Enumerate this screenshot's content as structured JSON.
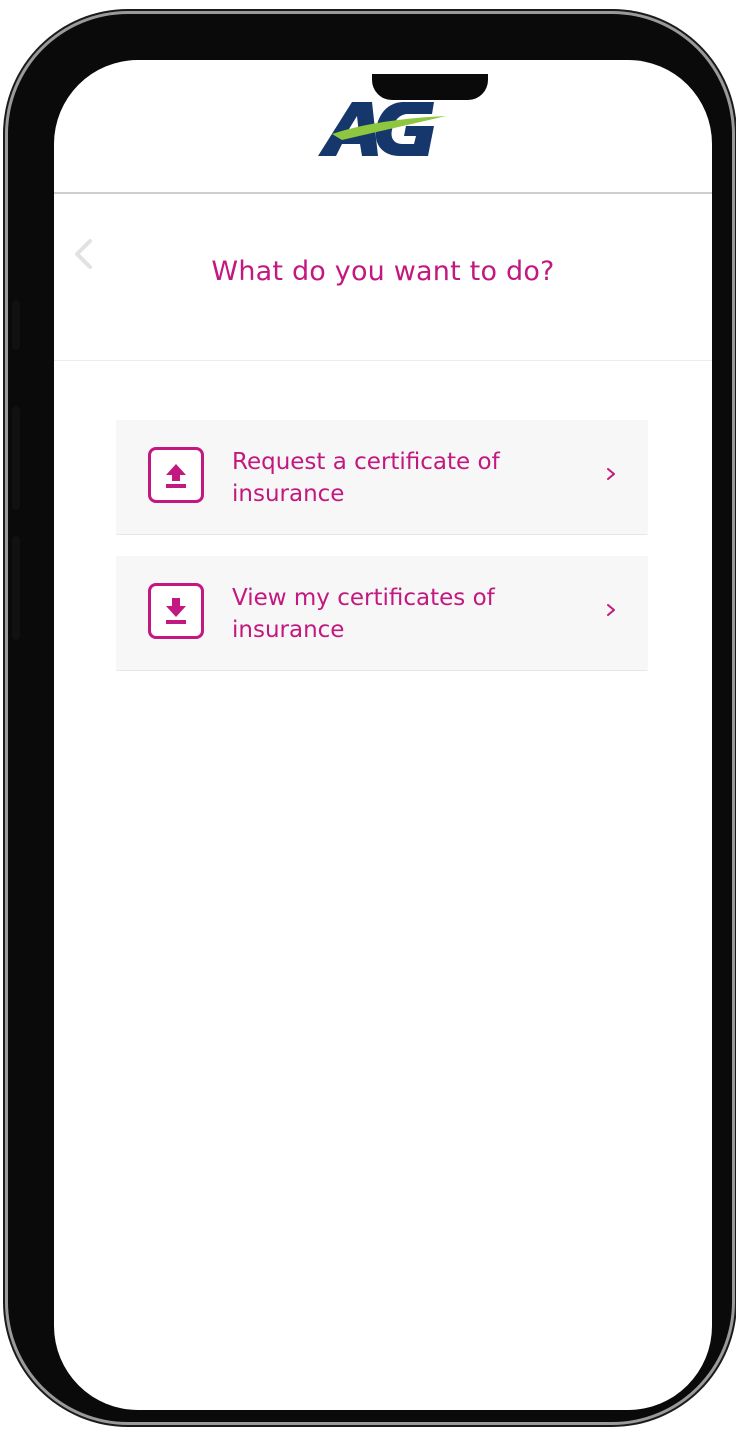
{
  "brand": {
    "logo_text": "AG",
    "primary_color": "#c2187f",
    "logo_navy": "#16376b",
    "logo_green": "#8dc63f"
  },
  "header": {
    "back_icon": "chevron-left-icon"
  },
  "page": {
    "title": "What do you want to do?"
  },
  "options": [
    {
      "label": "Request a certificate of insurance",
      "icon": "upload-icon",
      "chevron": "›"
    },
    {
      "label": "View my certificates of insurance",
      "icon": "download-icon",
      "chevron": "›"
    }
  ]
}
